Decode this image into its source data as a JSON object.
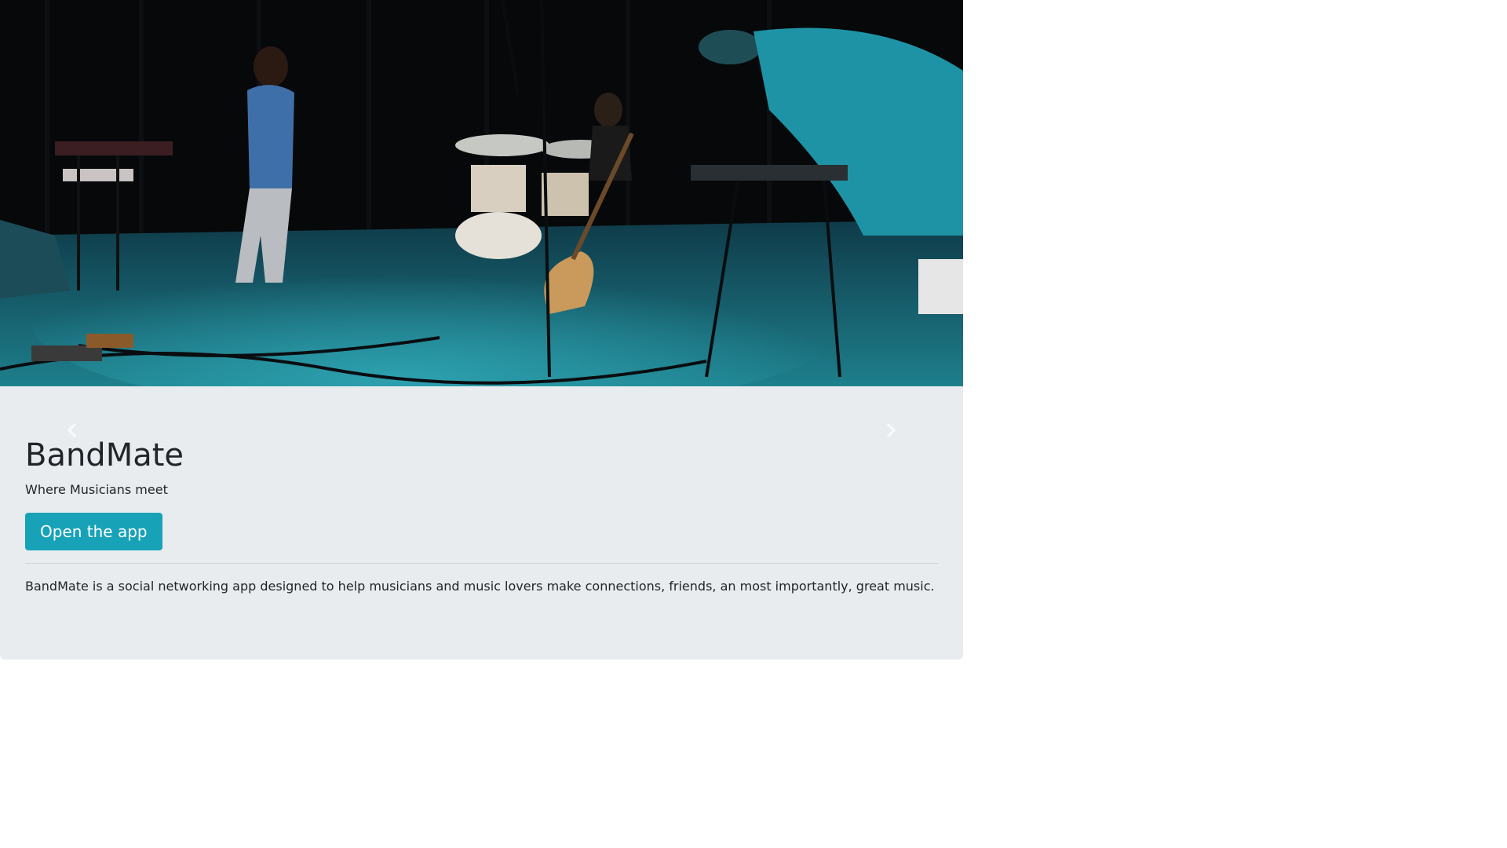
{
  "hero": {
    "image_alt": "Band performing on stage",
    "title": "BandMate",
    "tagline": "Where Musicians meet",
    "cta_label": "Open the app",
    "description": "BandMate is a social networking app designed to help musicians and music lovers make connections, friends, an most importantly, great music."
  },
  "carousel": {
    "prev_icon": "chevron-left-icon",
    "next_icon": "chevron-right-icon"
  },
  "colors": {
    "jumbotron_bg": "#e9ecef",
    "cta_bg": "#17a2b8",
    "cta_text": "#ffffff",
    "text": "#212529"
  }
}
